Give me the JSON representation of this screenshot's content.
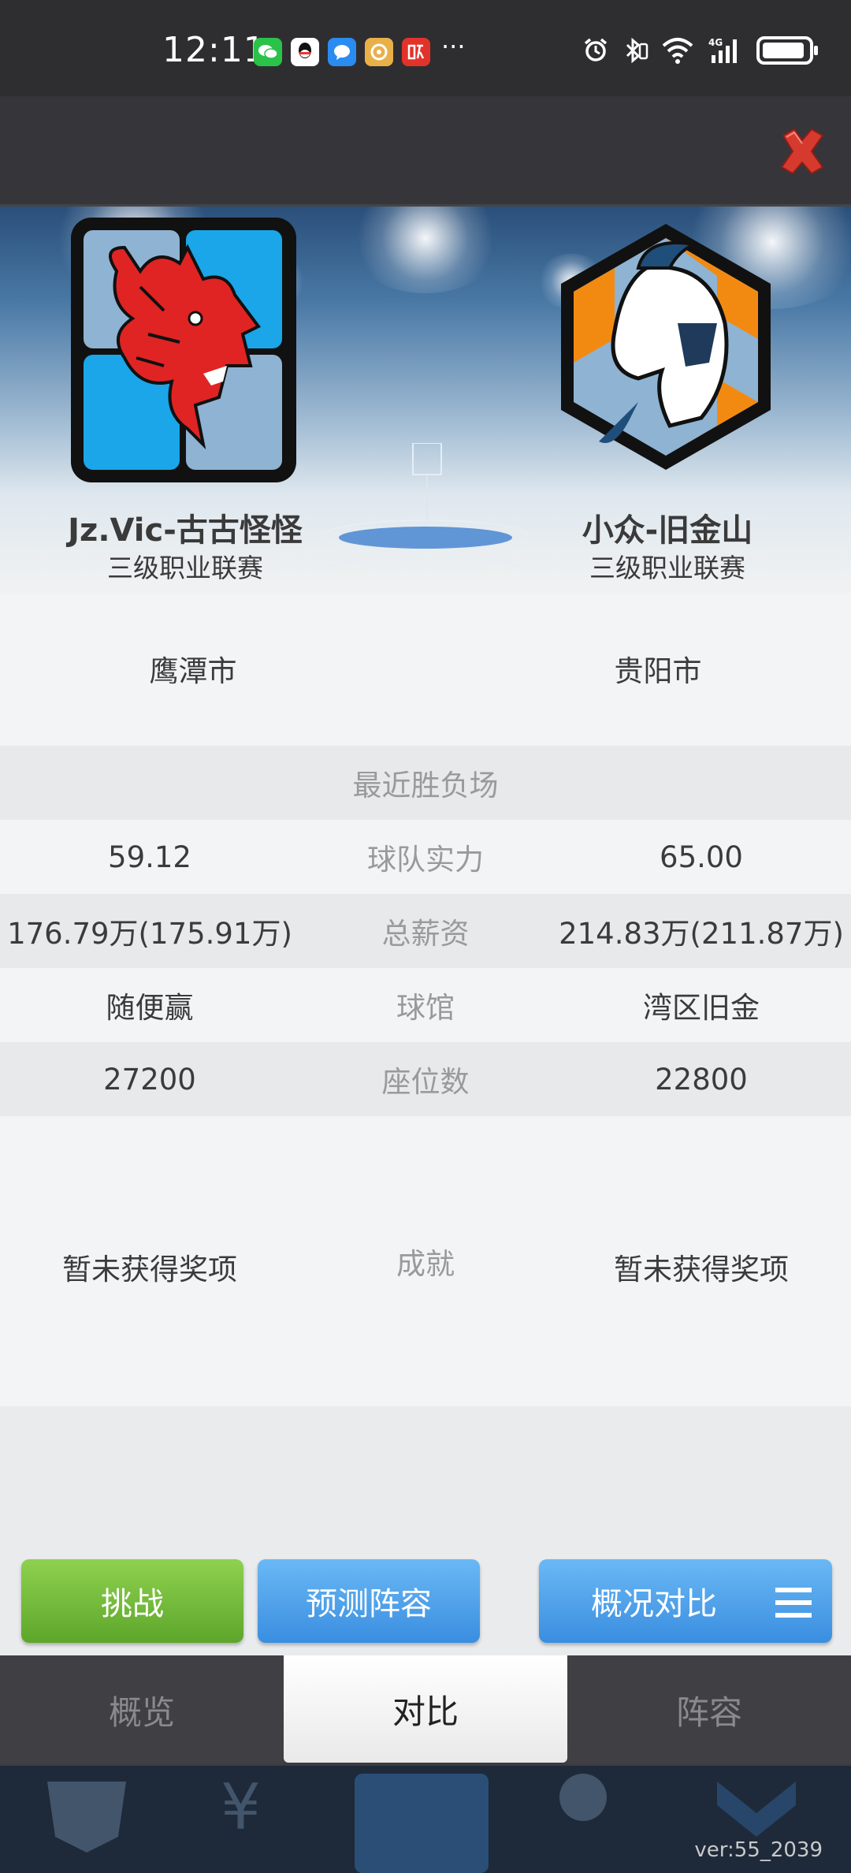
{
  "status_bar": {
    "time": "12:11",
    "more": "···",
    "app_icons": [
      "wechat-icon",
      "qq-icon",
      "message-icon",
      "music-icon",
      "listen-icon"
    ],
    "right_icons": [
      "alarm-icon",
      "bluetooth-icon",
      "wifi-icon",
      "signal-4g-icon",
      "battery-icon"
    ],
    "network": "4G"
  },
  "header": {
    "close_icon": "close-icon"
  },
  "teams": {
    "home": {
      "name": "Jz.Vic-古古怪怪",
      "league": "三级职业联赛",
      "logo": "dragon-logo-icon"
    },
    "away": {
      "name": "小众-旧金山",
      "league": "三级职业联赛",
      "logo": "spartan-helmet-logo-icon"
    }
  },
  "comparison": {
    "city": {
      "left": "鹰潭市",
      "right": "贵阳市"
    },
    "recent_label": "最近胜负场",
    "rows": [
      {
        "label": "球队实力",
        "left": "59.12",
        "right": "65.00"
      },
      {
        "label": "总薪资",
        "left": "176.79万(175.91万)",
        "right": "214.83万(211.87万)"
      },
      {
        "label": "球馆",
        "left": "随便赢",
        "right": "湾区旧金"
      },
      {
        "label": "座位数",
        "left": "27200",
        "right": "22800"
      }
    ],
    "achievement": {
      "label": "成就",
      "left": "暂未获得奖项",
      "right": "暂未获得奖项"
    }
  },
  "actions": {
    "challenge": "挑战",
    "predict_lineup": "预测阵容",
    "overview_compare": "概况对比"
  },
  "tabs": [
    "概览",
    "对比",
    "阵容"
  ],
  "active_tab": "对比",
  "version": "ver:55_2039",
  "colors": {
    "green": "#5da62b",
    "blue": "#3a8ee0",
    "close_red": "#d63a2f"
  }
}
